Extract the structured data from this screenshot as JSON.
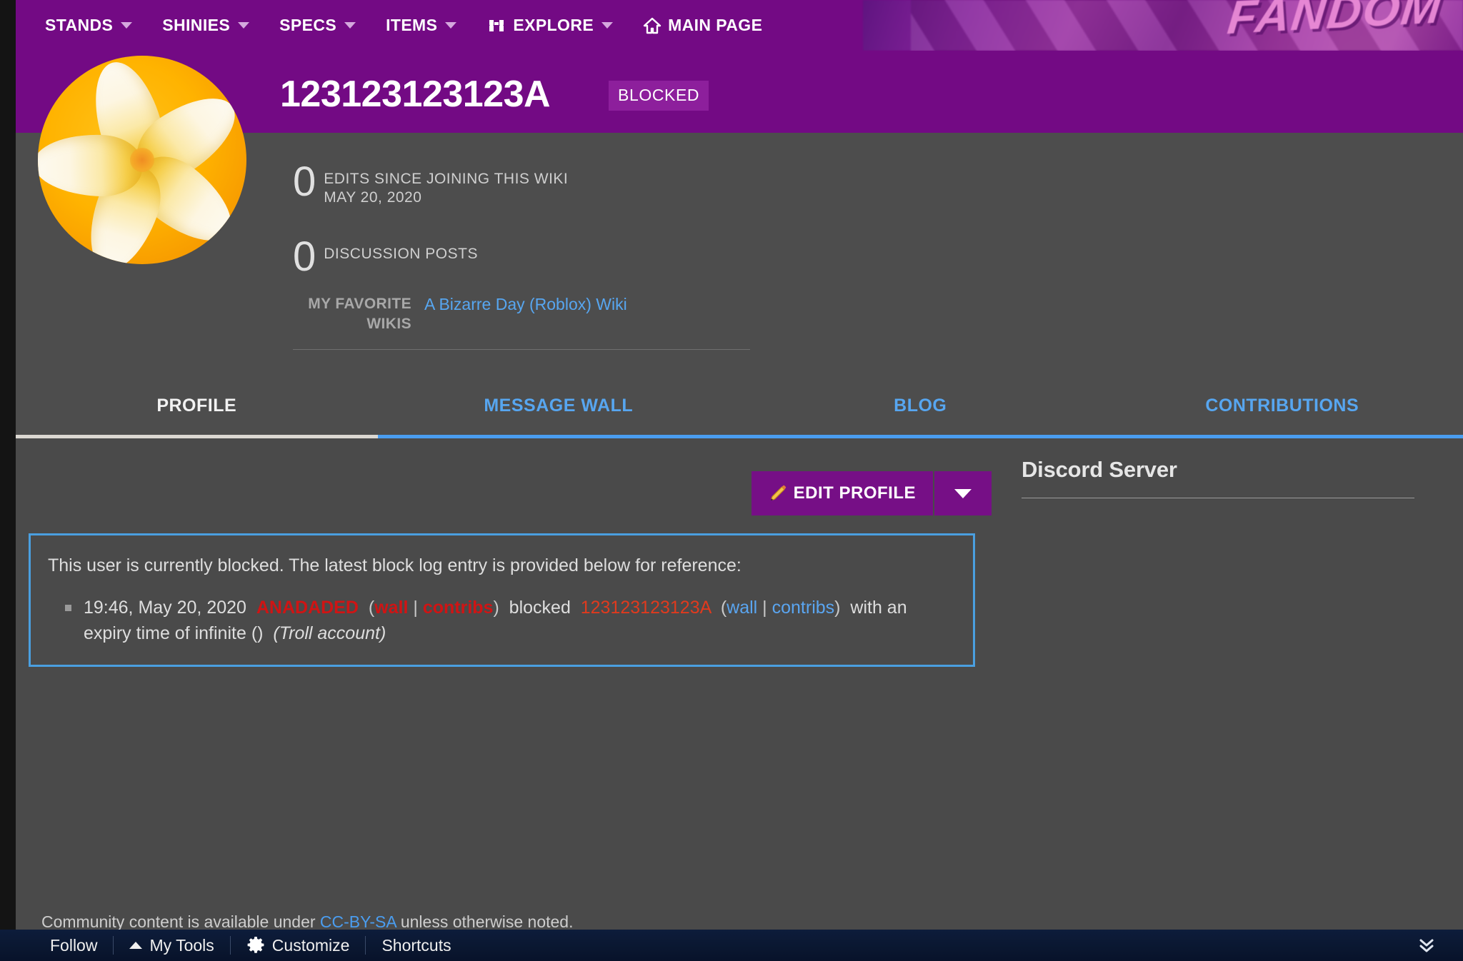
{
  "theme": {
    "brand_purple": "#730a84",
    "badge_purple": "#8d1f9c",
    "body_gray": "#4d4d4d",
    "content_gray": "#4a4a4a",
    "link_blue": "#57a6f0",
    "accent_underline": "#4a9df0",
    "notice_border": "#4a9fe0",
    "red_link": "#d01414",
    "red_link_light": "#e03a1e",
    "toolbar_navy": "#0d1c3b"
  },
  "global_nav": {
    "items": [
      {
        "label": "STANDS",
        "icon": "",
        "has_caret": true
      },
      {
        "label": "SHINIES",
        "icon": "",
        "has_caret": true
      },
      {
        "label": "SPECS",
        "icon": "",
        "has_caret": true
      },
      {
        "label": "ITEMS",
        "icon": "",
        "has_caret": true
      },
      {
        "label": "EXPLORE",
        "icon": "binoculars-icon",
        "has_caret": true
      },
      {
        "label": "MAIN PAGE",
        "icon": "home-icon",
        "has_caret": false
      }
    ],
    "wordmark": "FANDOM"
  },
  "profile": {
    "username": "123123123123A",
    "blocked_badge": "BLOCKED",
    "avatar_alt": "plumeria-flower-avatar",
    "stats": [
      {
        "number": "0",
        "label": "EDITS SINCE JOINING THIS WIKI",
        "sub": "MAY 20, 2020"
      },
      {
        "number": "0",
        "label": "DISCUSSION POSTS",
        "sub": ""
      }
    ],
    "favorite_wikis_label": "MY FAVORITE WIKIS",
    "favorite_wikis": [
      "A Bizarre Day (Roblox) Wiki"
    ]
  },
  "tabs": [
    {
      "label": "PROFILE",
      "active": true
    },
    {
      "label": "MESSAGE WALL",
      "active": false
    },
    {
      "label": "BLOG",
      "active": false
    },
    {
      "label": "CONTRIBUTIONS",
      "active": false
    }
  ],
  "actions": {
    "edit_profile_label": "EDIT PROFILE",
    "edit_profile_icon": "pencil-icon",
    "dropdown_icon": "chevron-down-icon"
  },
  "block_notice": {
    "heading": "This user is currently blocked. The latest block log entry is provided below for reference:",
    "entry": {
      "timestamp": "19:46, May 20, 2020",
      "admin": "ANADADED",
      "admin_wall": "wall",
      "admin_contribs": "contribs",
      "verb": "blocked",
      "target": "123123123123A",
      "target_wall": "wall",
      "target_contribs": "contribs",
      "expiry_text": "with an expiry time of infinite ()",
      "reason": "(Troll account)",
      "separator": "|",
      "paren_open": "(",
      "paren_close": ")"
    }
  },
  "right_rail": {
    "title": "Discord Server"
  },
  "footer": {
    "license_prefix": "Community content is available under ",
    "license_link": "CC-BY-SA",
    "license_suffix": " unless otherwise noted."
  },
  "toolbar": {
    "items": [
      {
        "label": "Follow",
        "icon": ""
      },
      {
        "label": "My Tools",
        "icon": "caret-up-icon"
      },
      {
        "label": "Customize",
        "icon": "gear-icon"
      },
      {
        "label": "Shortcuts",
        "icon": ""
      }
    ],
    "collapse_icon": "double-chevron-down-icon"
  }
}
